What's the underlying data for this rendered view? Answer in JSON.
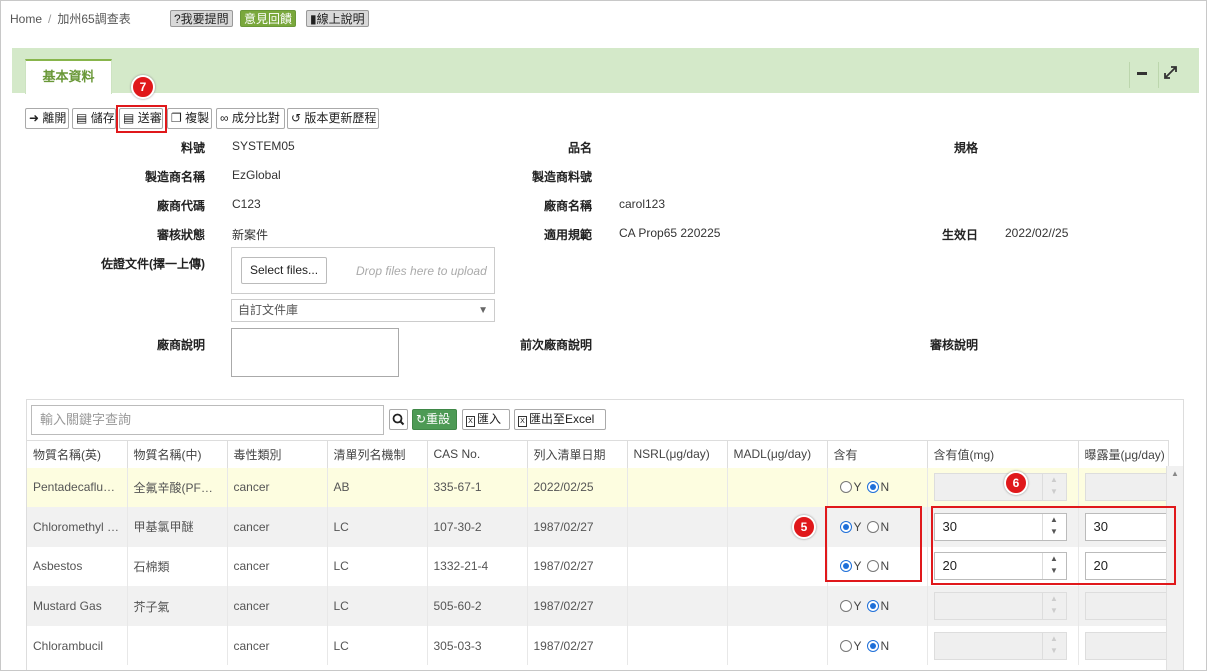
{
  "breadcrumb": {
    "home": "Home",
    "separator": "/",
    "current": "加州65調查表"
  },
  "top_buttons": {
    "ask": "?我要提問",
    "feedback": "意見回饋",
    "manual": "線上說明"
  },
  "tab": {
    "label": "基本資料"
  },
  "header_icons": {
    "minimize": "minus-icon",
    "expand": "expand-icon"
  },
  "actions": {
    "leave": "離開",
    "save": "儲存",
    "submit": "送審",
    "copy": "複製",
    "compare": "成分比對",
    "history": "版本更新歷程"
  },
  "badges": {
    "submit": "7",
    "checkbox": "5",
    "value": "6"
  },
  "form": {
    "part_no_label": "料號",
    "part_no": "SYSTEM05",
    "product_name_label": "品名",
    "product_name": "",
    "spec_label": "規格",
    "spec": "",
    "maker_label": "製造商名稱",
    "maker": "EzGlobal",
    "maker_part_label": "製造商料號",
    "maker_part": "",
    "vendor_code_label": "廠商代碼",
    "vendor_code": "C123",
    "vendor_name_label": "廠商名稱",
    "vendor_name": "carol123",
    "review_status_label": "審核狀態",
    "review_status": "新案件",
    "regulation_label": "適用規範",
    "regulation": "CA Prop65 220225",
    "effective_label": "生效日",
    "effective": "2022/02//25",
    "evidence_label": "佐證文件(擇一上傳)",
    "select_files": "Select files...",
    "drop_hint": "Drop files here to upload",
    "doc_library": "自訂文件庫",
    "vendor_note_label": "廠商說明",
    "prev_vendor_note_label": "前次廠商說明",
    "review_note_label": "審核說明"
  },
  "grid": {
    "search_placeholder": "輸入關鍵字查詢",
    "reset": "重設",
    "import": "匯入",
    "export": "匯出至Excel",
    "columns": [
      "物質名稱(英)",
      "物質名稱(中)",
      "毒性類別",
      "清單列名機制",
      "CAS No.",
      "列入清單日期",
      "NSRL(μg/day)",
      "MADL(μg/day)",
      "含有",
      "含有值(mg)",
      "曝露量(μg/day)"
    ],
    "rows": [
      {
        "en": "Pentadecaflu…",
        "zh": "全氟辛酸(PF…",
        "tox": "cancer",
        "mech": "AB",
        "cas": "335-67-1",
        "date": "2022/02/25",
        "nsrl": "",
        "madl": "",
        "contains": "N",
        "value": "",
        "exposure": ""
      },
      {
        "en": "Chloromethyl …",
        "zh": "甲基氯甲醚",
        "tox": "cancer",
        "mech": "LC",
        "cas": "107-30-2",
        "date": "1987/02/27",
        "nsrl": "",
        "madl": "",
        "contains": "Y",
        "value": "30",
        "exposure": "30"
      },
      {
        "en": "Asbestos",
        "zh": "石棉類",
        "tox": "cancer",
        "mech": "LC",
        "cas": "1332-21-4",
        "date": "1987/02/27",
        "nsrl": "",
        "madl": "",
        "contains": "Y",
        "value": "20",
        "exposure": "20"
      },
      {
        "en": "Mustard Gas",
        "zh": "芥子氣",
        "tox": "cancer",
        "mech": "LC",
        "cas": "505-60-2",
        "date": "1987/02/27",
        "nsrl": "",
        "madl": "",
        "contains": "N",
        "value": "",
        "exposure": ""
      },
      {
        "en": "Chlorambucil",
        "zh": "",
        "tox": "cancer",
        "mech": "LC",
        "cas": "305-03-3",
        "date": "1987/02/27",
        "nsrl": "",
        "madl": "",
        "contains": "N",
        "value": "",
        "exposure": ""
      }
    ],
    "yes": "Y",
    "no": "N"
  },
  "colors": {
    "accent_green": "#88b54c",
    "header_bg": "#d4e9c9",
    "highlight": "#e0181b",
    "radio": "#1e6fd9"
  }
}
